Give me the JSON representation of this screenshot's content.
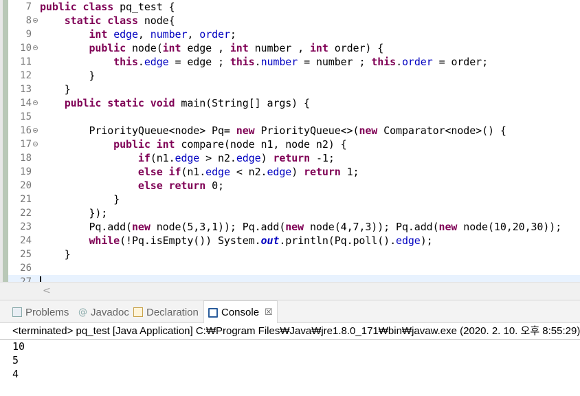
{
  "editor": {
    "lines": [
      {
        "n": "7",
        "fold": false,
        "t": [
          [
            "kw",
            "public class "
          ],
          [
            "p",
            "pq_test {"
          ]
        ]
      },
      {
        "n": "8",
        "fold": true,
        "t": [
          [
            "p",
            "    "
          ],
          [
            "kw",
            "static class "
          ],
          [
            "p",
            "node{"
          ]
        ]
      },
      {
        "n": "9",
        "fold": false,
        "t": [
          [
            "p",
            "        "
          ],
          [
            "kw",
            "int "
          ],
          [
            "fld",
            "edge"
          ],
          [
            "p",
            ", "
          ],
          [
            "fld",
            "number"
          ],
          [
            "p",
            ", "
          ],
          [
            "fld",
            "order"
          ],
          [
            "p",
            ";"
          ]
        ]
      },
      {
        "n": "10",
        "fold": true,
        "t": [
          [
            "p",
            "        "
          ],
          [
            "kw",
            "public "
          ],
          [
            "p",
            "node("
          ],
          [
            "kw",
            "int "
          ],
          [
            "p",
            "edge , "
          ],
          [
            "kw",
            "int "
          ],
          [
            "p",
            "number , "
          ],
          [
            "kw",
            "int "
          ],
          [
            "p",
            "order) {"
          ]
        ]
      },
      {
        "n": "11",
        "fold": false,
        "t": [
          [
            "p",
            "            "
          ],
          [
            "kw",
            "this"
          ],
          [
            "p",
            "."
          ],
          [
            "fld",
            "edge"
          ],
          [
            "p",
            " = edge ; "
          ],
          [
            "kw",
            "this"
          ],
          [
            "p",
            "."
          ],
          [
            "fld",
            "number"
          ],
          [
            "p",
            " = number ; "
          ],
          [
            "kw",
            "this"
          ],
          [
            "p",
            "."
          ],
          [
            "fld",
            "order"
          ],
          [
            "p",
            " = order;"
          ]
        ]
      },
      {
        "n": "12",
        "fold": false,
        "t": [
          [
            "p",
            "        }"
          ]
        ]
      },
      {
        "n": "13",
        "fold": false,
        "t": [
          [
            "p",
            "    }"
          ]
        ]
      },
      {
        "n": "14",
        "fold": true,
        "t": [
          [
            "p",
            "    "
          ],
          [
            "kw",
            "public static void "
          ],
          [
            "p",
            "main(String[] args) {"
          ]
        ]
      },
      {
        "n": "15",
        "fold": false,
        "t": [
          [
            "p",
            ""
          ]
        ]
      },
      {
        "n": "16",
        "fold": true,
        "t": [
          [
            "p",
            "        PriorityQueue<node> Pq= "
          ],
          [
            "kw",
            "new "
          ],
          [
            "p",
            "PriorityQueue<>("
          ],
          [
            "kw",
            "new "
          ],
          [
            "p",
            "Comparator<node>() {"
          ]
        ]
      },
      {
        "n": "17",
        "fold": true,
        "t": [
          [
            "p",
            "            "
          ],
          [
            "kw",
            "public int "
          ],
          [
            "p",
            "compare(node n1, node n2) {"
          ]
        ]
      },
      {
        "n": "18",
        "fold": false,
        "t": [
          [
            "p",
            "                "
          ],
          [
            "kw",
            "if"
          ],
          [
            "p",
            "(n1."
          ],
          [
            "fld",
            "edge"
          ],
          [
            "p",
            " > n2."
          ],
          [
            "fld",
            "edge"
          ],
          [
            "p",
            ") "
          ],
          [
            "kw",
            "return "
          ],
          [
            "p",
            "-1;"
          ]
        ]
      },
      {
        "n": "19",
        "fold": false,
        "t": [
          [
            "p",
            "                "
          ],
          [
            "kw",
            "else if"
          ],
          [
            "p",
            "(n1."
          ],
          [
            "fld",
            "edge"
          ],
          [
            "p",
            " < n2."
          ],
          [
            "fld",
            "edge"
          ],
          [
            "p",
            ") "
          ],
          [
            "kw",
            "return "
          ],
          [
            "p",
            "1;"
          ]
        ]
      },
      {
        "n": "20",
        "fold": false,
        "t": [
          [
            "p",
            "                "
          ],
          [
            "kw",
            "else return "
          ],
          [
            "p",
            "0;"
          ]
        ]
      },
      {
        "n": "21",
        "fold": false,
        "t": [
          [
            "p",
            "            }"
          ]
        ]
      },
      {
        "n": "22",
        "fold": false,
        "t": [
          [
            "p",
            "        });"
          ]
        ]
      },
      {
        "n": "23",
        "fold": false,
        "t": [
          [
            "p",
            "        Pq.add("
          ],
          [
            "kw",
            "new "
          ],
          [
            "p",
            "node(5,3,1)); Pq.add("
          ],
          [
            "kw",
            "new "
          ],
          [
            "p",
            "node(4,7,3)); Pq.add("
          ],
          [
            "kw",
            "new "
          ],
          [
            "p",
            "node(10,20,30));"
          ]
        ]
      },
      {
        "n": "24",
        "fold": false,
        "t": [
          [
            "p",
            "        "
          ],
          [
            "kw",
            "while"
          ],
          [
            "p",
            "(!Pq.isEmpty()) System."
          ],
          [
            "sfld",
            "out"
          ],
          [
            "p",
            ".println(Pq.poll()."
          ],
          [
            "fld",
            "edge"
          ],
          [
            "p",
            ");"
          ]
        ]
      },
      {
        "n": "25",
        "fold": false,
        "t": [
          [
            "p",
            "    }"
          ]
        ]
      },
      {
        "n": "26",
        "fold": false,
        "t": [
          [
            "p",
            ""
          ]
        ]
      },
      {
        "n": "27",
        "fold": false,
        "t": [
          [
            "p",
            ""
          ]
        ]
      }
    ]
  },
  "hscroll": {
    "left_arrow": "<"
  },
  "views": {
    "problems": "Problems",
    "javadoc": "Javadoc",
    "declaration": "Declaration",
    "console": "Console",
    "close": "☒"
  },
  "console": {
    "terminated": "<terminated> pq_test [Java Application] C:₩Program Files₩Java₩jre1.8.0_171₩bin₩javaw.exe (2020. 2. 10. 오후 8:55:29)",
    "output": [
      "10",
      "5",
      "4"
    ]
  }
}
